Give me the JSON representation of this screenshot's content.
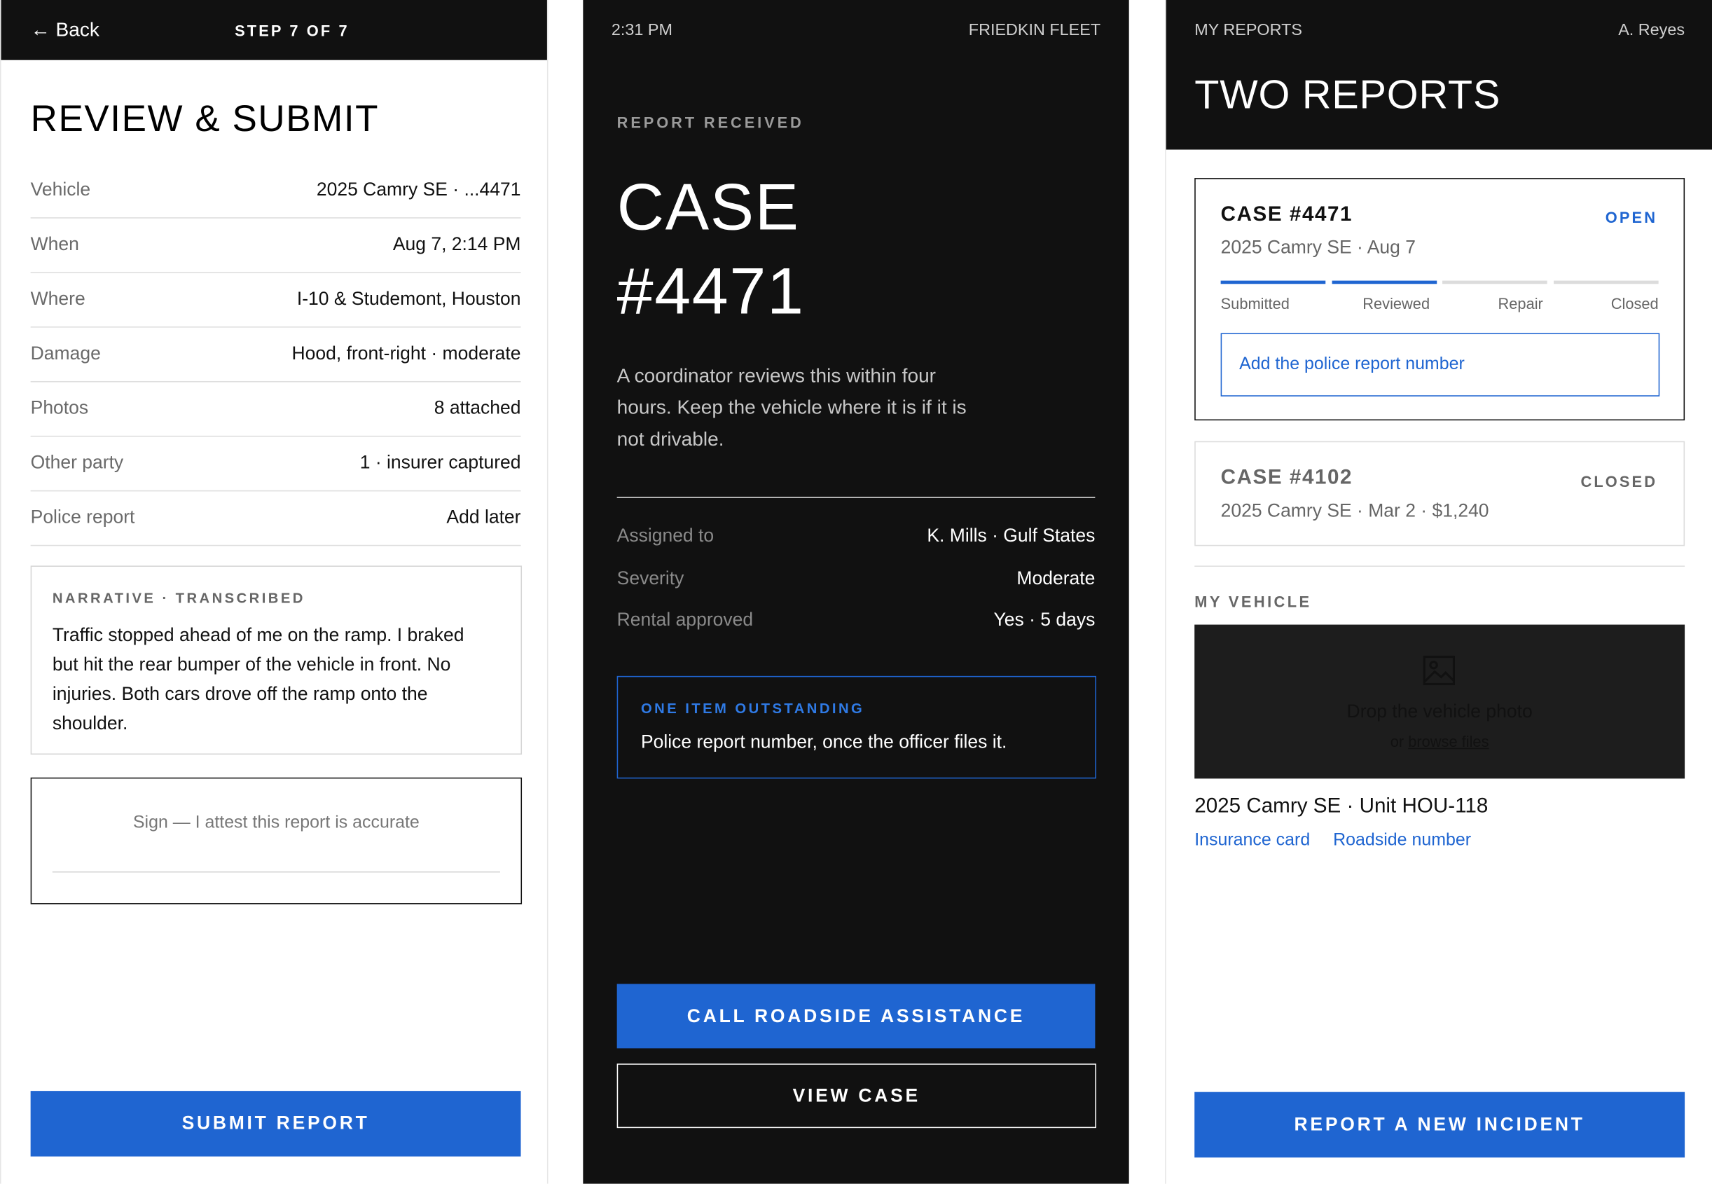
{
  "review": {
    "back_label": "← Back",
    "step_label": "STEP 7 OF 7",
    "title": "REVIEW & SUBMIT",
    "rows": [
      {
        "label": "Vehicle",
        "value": "2025 Camry SE · ...4471"
      },
      {
        "label": "When",
        "value": "Aug 7, 2:14 PM"
      },
      {
        "label": "Where",
        "value": "I-10 & Studemont, Houston"
      },
      {
        "label": "Damage",
        "value": "Hood, front-right · moderate"
      },
      {
        "label": "Photos",
        "value": "8 attached"
      },
      {
        "label": "Other party",
        "value": "1 · insurer captured"
      },
      {
        "label": "Police report",
        "value": "Add later"
      }
    ],
    "narrative_caption": "NARRATIVE · TRANSCRIBED",
    "narrative_text": "Traffic stopped ahead of me on the ramp. I braked but hit the rear bumper of the vehicle in front. No injuries. Both cars drove off the ramp onto the shoulder.",
    "sign_label": "Sign — I attest this report is accurate",
    "submit_label": "SUBMIT REPORT"
  },
  "received": {
    "time": "2:31 PM",
    "fleet": "FRIEDKIN FLEET",
    "eyebrow": "REPORT RECEIVED",
    "case_word": "CASE",
    "case_number": "#4471",
    "message": "A coordinator reviews this within four hours. Keep the vehicle where it is if it is not drivable.",
    "details": [
      {
        "label": "Assigned to",
        "value": "K. Mills · Gulf States"
      },
      {
        "label": "Severity",
        "value": "Moderate"
      },
      {
        "label": "Rental approved",
        "value": "Yes · 5 days"
      }
    ],
    "outstanding_caption": "ONE ITEM OUTSTANDING",
    "outstanding_text": "Police report number, once the officer files it.",
    "call_label": "CALL ROADSIDE ASSISTANCE",
    "view_label": "VIEW CASE"
  },
  "reports": {
    "section": "MY REPORTS",
    "user": "A. Reyes",
    "title": "TWO REPORTS",
    "cases": [
      {
        "title": "CASE #4471",
        "status": "OPEN",
        "subtitle": "2025 Camry SE · Aug 7",
        "steps": [
          "Submitted",
          "Reviewed",
          "Repair",
          "Closed"
        ],
        "progress": 0.5,
        "action": "Add the police report number"
      },
      {
        "title": "CASE #4102",
        "status": "CLOSED",
        "subtitle": "2025 Camry SE · Mar 2 · $1,240"
      }
    ],
    "vehicle_caption": "MY VEHICLE",
    "drop_title": "Drop the vehicle photo",
    "drop_or": "or",
    "drop_browse": "browse files",
    "vehicle_name": "2025 Camry SE · Unit HOU-118",
    "link_insurance": "Insurance card",
    "link_roadside": "Roadside number",
    "new_incident_label": "REPORT A NEW INCIDENT"
  },
  "colors": {
    "accent": "#1f65d1",
    "dark": "#111111"
  }
}
